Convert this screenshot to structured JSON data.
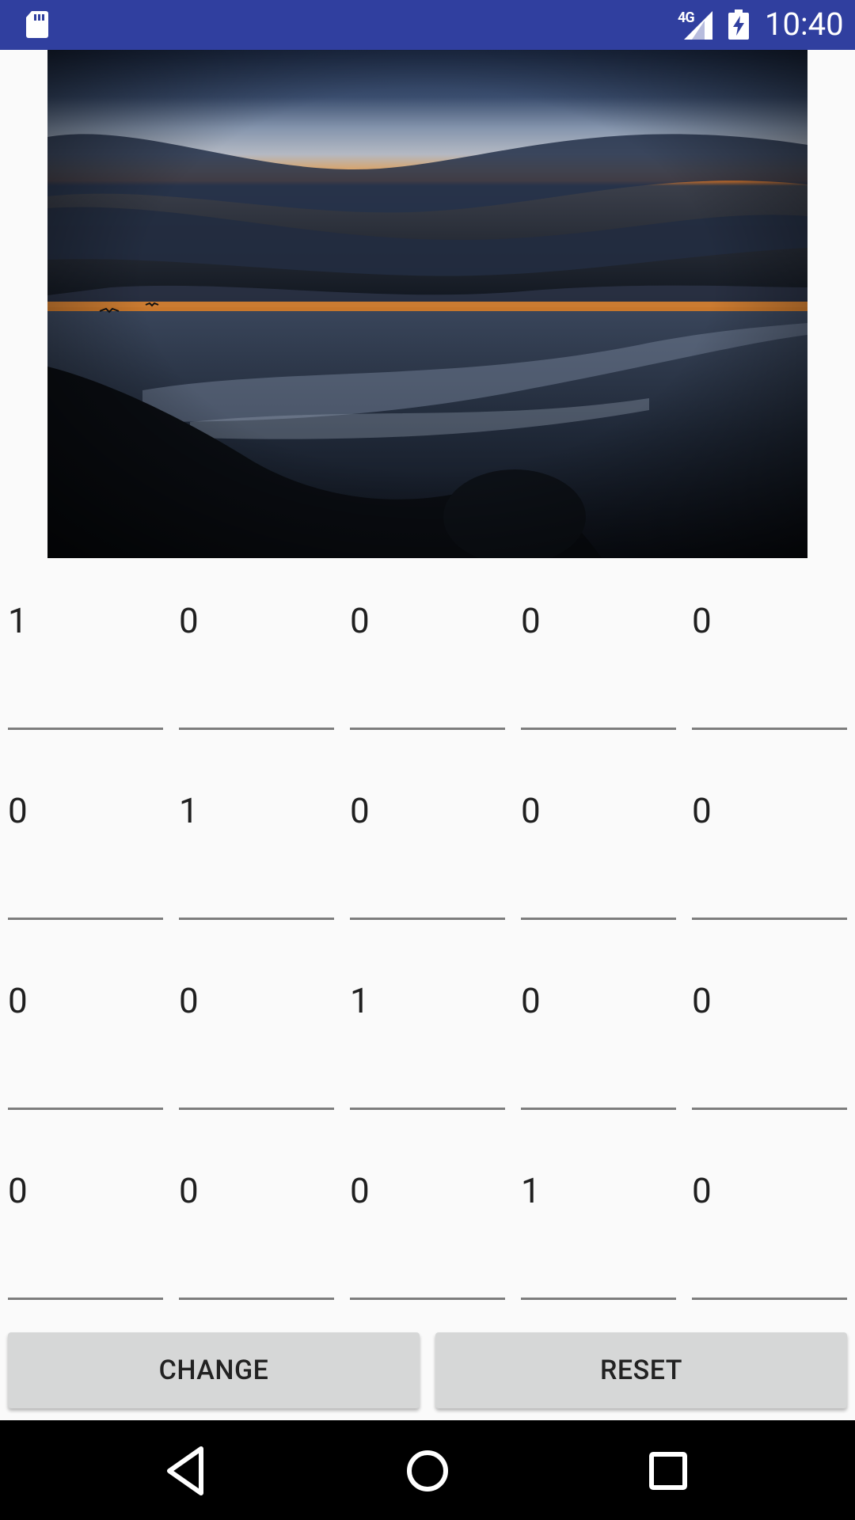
{
  "status_bar": {
    "network_type": "4G",
    "time": "10:40",
    "icons": [
      "sd-card-icon",
      "signal-icon",
      "battery-charging-icon"
    ]
  },
  "photo": {
    "subject": "sunset-over-ocean-image"
  },
  "matrix": {
    "rows": [
      [
        "1",
        "0",
        "0",
        "0",
        "0"
      ],
      [
        "0",
        "1",
        "0",
        "0",
        "0"
      ],
      [
        "0",
        "0",
        "1",
        "0",
        "0"
      ],
      [
        "0",
        "0",
        "0",
        "1",
        "0"
      ]
    ]
  },
  "buttons": {
    "change_label": "CHANGE",
    "reset_label": "RESET"
  },
  "nav": {
    "icons": [
      "back-icon",
      "home-icon",
      "recents-icon"
    ]
  },
  "colors": {
    "status_bar": "#303f9f",
    "background": "#fafafa",
    "button": "#d6d7d7",
    "underline": "#7d7d7d"
  }
}
